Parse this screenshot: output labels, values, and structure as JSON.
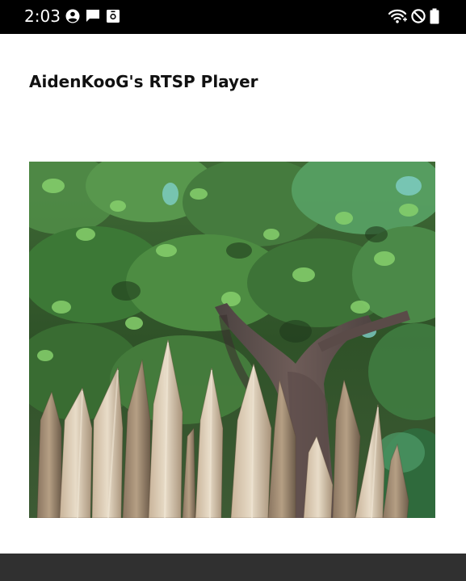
{
  "status_bar": {
    "time": "2:03",
    "icons_left": [
      "account-circle-icon",
      "chat-bubble-icon",
      "screen-record-icon"
    ],
    "icons_right": [
      "wifi-icon",
      "do-not-disturb-icon",
      "battery-icon"
    ],
    "background": "#000000"
  },
  "app": {
    "title": "AidenKooG's RTSP Player"
  },
  "player": {
    "content": "rtsp-video-frame",
    "scene": "tree-and-wooden-stake-fence"
  },
  "nav_bar": {
    "background": "#303030"
  }
}
